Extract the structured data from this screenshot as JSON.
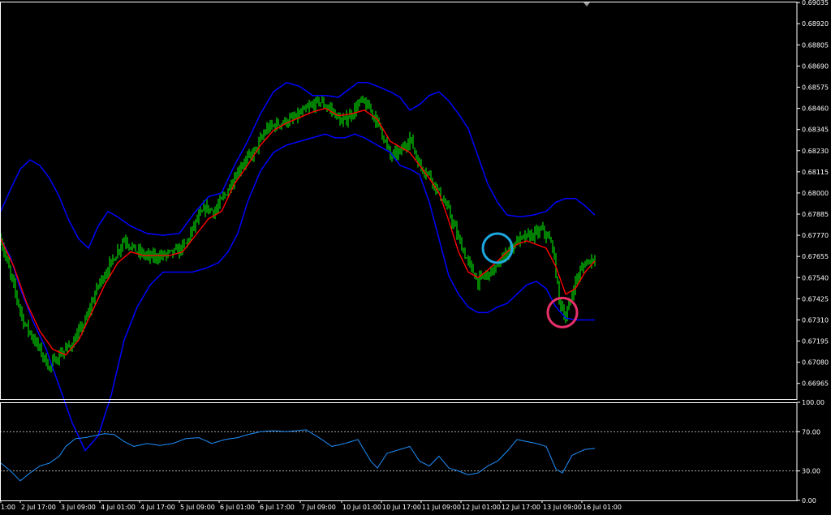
{
  "colors": {
    "background": "#000000",
    "frame": "#ffffff",
    "candle": "#00ff00",
    "moving_average": "#ff0000",
    "bollinger": "#0000ff",
    "rsi": "#1e90ff",
    "rsi_levels": "#c0c0c0",
    "annotation_blue": "#1ea8e0",
    "annotation_pink": "#e8306a"
  },
  "chart_data": [
    {
      "type": "candlestick",
      "panel": "price",
      "ylim": [
        0.6688,
        0.6904
      ],
      "y_ticks": [
        "0.69035",
        "0.68920",
        "0.68805",
        "0.68690",
        "0.68575",
        "0.68460",
        "0.68345",
        "0.68230",
        "0.68115",
        "0.68000",
        "0.67885",
        "0.67770",
        "0.67655",
        "0.67540",
        "0.67425",
        "0.67310",
        "0.67195",
        "0.67080",
        "0.66965"
      ],
      "x_ticks": [
        "1:00",
        "2 Jul 17:00",
        "3 Jul 09:00",
        "4 Jul 01:00",
        "4 Jul 17:00",
        "5 Jul 09:00",
        "6 Jul 01:00",
        "6 Jul 17:00",
        "7 Jul 09:00",
        "10 Jul 01:00",
        "10 Jul 17:00",
        "11 Jul 09:00",
        "12 Jul 01:00",
        "12 Jul 17:00",
        "13 Jul 09:00",
        "16 Jul 01:00"
      ],
      "close_anchors": [
        [
          0,
          0.6775
        ],
        [
          6,
          0.6755
        ],
        [
          14,
          0.673
        ],
        [
          22,
          0.6718
        ],
        [
          30,
          0.6705
        ],
        [
          36,
          0.6712
        ],
        [
          44,
          0.6718
        ],
        [
          52,
          0.673
        ],
        [
          60,
          0.675
        ],
        [
          68,
          0.6762
        ],
        [
          76,
          0.6775
        ],
        [
          84,
          0.6768
        ],
        [
          92,
          0.6765
        ],
        [
          100,
          0.6766
        ],
        [
          108,
          0.6768
        ],
        [
          114,
          0.6772
        ],
        [
          120,
          0.6784
        ],
        [
          126,
          0.6792
        ],
        [
          132,
          0.679
        ],
        [
          140,
          0.6802
        ],
        [
          148,
          0.6815
        ],
        [
          156,
          0.6822
        ],
        [
          164,
          0.6835
        ],
        [
          172,
          0.6838
        ],
        [
          180,
          0.684
        ],
        [
          188,
          0.6845
        ],
        [
          196,
          0.685
        ],
        [
          204,
          0.6845
        ],
        [
          210,
          0.6838
        ],
        [
          216,
          0.6843
        ],
        [
          222,
          0.685
        ],
        [
          228,
          0.6845
        ],
        [
          234,
          0.6835
        ],
        [
          240,
          0.682
        ],
        [
          246,
          0.6822
        ],
        [
          252,
          0.683
        ],
        [
          258,
          0.6815
        ],
        [
          264,
          0.681
        ],
        [
          270,
          0.68
        ],
        [
          276,
          0.679
        ],
        [
          282,
          0.6775
        ],
        [
          288,
          0.6762
        ],
        [
          294,
          0.6752
        ],
        [
          300,
          0.6756
        ],
        [
          306,
          0.676
        ],
        [
          312,
          0.6768
        ],
        [
          318,
          0.6774
        ],
        [
          324,
          0.6776
        ],
        [
          330,
          0.6778
        ],
        [
          334,
          0.678
        ],
        [
          340,
          0.6771
        ],
        [
          344,
          0.6742
        ],
        [
          348,
          0.6732
        ],
        [
          354,
          0.6752
        ],
        [
          360,
          0.6762
        ],
        [
          366,
          0.6765
        ]
      ],
      "ma_anchors": [
        [
          0,
          0.6775
        ],
        [
          8,
          0.676
        ],
        [
          16,
          0.674
        ],
        [
          24,
          0.6725
        ],
        [
          32,
          0.6715
        ],
        [
          40,
          0.6712
        ],
        [
          48,
          0.672
        ],
        [
          56,
          0.6735
        ],
        [
          64,
          0.675
        ],
        [
          72,
          0.6762
        ],
        [
          80,
          0.6768
        ],
        [
          88,
          0.6766
        ],
        [
          96,
          0.6766
        ],
        [
          104,
          0.6766
        ],
        [
          112,
          0.6768
        ],
        [
          120,
          0.6777
        ],
        [
          128,
          0.6786
        ],
        [
          136,
          0.679
        ],
        [
          144,
          0.6805
        ],
        [
          152,
          0.6815
        ],
        [
          160,
          0.6826
        ],
        [
          168,
          0.6834
        ],
        [
          176,
          0.6838
        ],
        [
          184,
          0.6841
        ],
        [
          192,
          0.6844
        ],
        [
          200,
          0.6846
        ],
        [
          208,
          0.6842
        ],
        [
          216,
          0.6843
        ],
        [
          224,
          0.6845
        ],
        [
          232,
          0.684
        ],
        [
          240,
          0.6828
        ],
        [
          246,
          0.6825
        ],
        [
          252,
          0.6822
        ],
        [
          258,
          0.6815
        ],
        [
          264,
          0.6808
        ],
        [
          270,
          0.68
        ],
        [
          276,
          0.6785
        ],
        [
          282,
          0.6768
        ],
        [
          288,
          0.6757
        ],
        [
          294,
          0.6754
        ],
        [
          300,
          0.6758
        ],
        [
          306,
          0.6763
        ],
        [
          312,
          0.6768
        ],
        [
          318,
          0.6772
        ],
        [
          324,
          0.6774
        ],
        [
          330,
          0.6772
        ],
        [
          336,
          0.677
        ],
        [
          342,
          0.676
        ],
        [
          348,
          0.6745
        ],
        [
          354,
          0.6748
        ],
        [
          360,
          0.6757
        ],
        [
          366,
          0.6763
        ]
      ],
      "bollinger_upper_anchors": [
        [
          0,
          0.679
        ],
        [
          6,
          0.6802
        ],
        [
          12,
          0.6813
        ],
        [
          18,
          0.6818
        ],
        [
          24,
          0.6815
        ],
        [
          30,
          0.6808
        ],
        [
          36,
          0.6798
        ],
        [
          42,
          0.6785
        ],
        [
          48,
          0.6775
        ],
        [
          54,
          0.677
        ],
        [
          60,
          0.6782
        ],
        [
          66,
          0.679
        ],
        [
          72,
          0.6787
        ],
        [
          80,
          0.6782
        ],
        [
          90,
          0.6778
        ],
        [
          100,
          0.6777
        ],
        [
          110,
          0.6778
        ],
        [
          120,
          0.679
        ],
        [
          128,
          0.6798
        ],
        [
          136,
          0.68
        ],
        [
          144,
          0.6815
        ],
        [
          152,
          0.6828
        ],
        [
          160,
          0.6843
        ],
        [
          168,
          0.6855
        ],
        [
          176,
          0.686
        ],
        [
          184,
          0.6858
        ],
        [
          192,
          0.6853
        ],
        [
          200,
          0.6853
        ],
        [
          208,
          0.6852
        ],
        [
          214,
          0.6856
        ],
        [
          220,
          0.686
        ],
        [
          226,
          0.686
        ],
        [
          232,
          0.6858
        ],
        [
          240,
          0.6855
        ],
        [
          246,
          0.6852
        ],
        [
          252,
          0.6845
        ],
        [
          258,
          0.6848
        ],
        [
          264,
          0.6853
        ],
        [
          270,
          0.6855
        ],
        [
          276,
          0.685
        ],
        [
          282,
          0.6843
        ],
        [
          288,
          0.6835
        ],
        [
          294,
          0.682
        ],
        [
          300,
          0.6805
        ],
        [
          306,
          0.6795
        ],
        [
          312,
          0.6788
        ],
        [
          320,
          0.6787
        ],
        [
          328,
          0.6788
        ],
        [
          336,
          0.679
        ],
        [
          342,
          0.6795
        ],
        [
          348,
          0.6797
        ],
        [
          354,
          0.6797
        ],
        [
          360,
          0.6793
        ],
        [
          366,
          0.6788
        ]
      ],
      "bollinger_lower_anchors": [
        [
          0,
          0.6775
        ],
        [
          6,
          0.6765
        ],
        [
          12,
          0.6748
        ],
        [
          20,
          0.673
        ],
        [
          28,
          0.6715
        ],
        [
          36,
          0.6695
        ],
        [
          44,
          0.6675
        ],
        [
          52,
          0.666
        ],
        [
          60,
          0.6668
        ],
        [
          68,
          0.669
        ],
        [
          76,
          0.672
        ],
        [
          84,
          0.6738
        ],
        [
          92,
          0.675
        ],
        [
          100,
          0.6757
        ],
        [
          110,
          0.6757
        ],
        [
          118,
          0.6757
        ],
        [
          126,
          0.6759
        ],
        [
          134,
          0.6762
        ],
        [
          140,
          0.6768
        ],
        [
          146,
          0.6778
        ],
        [
          152,
          0.6795
        ],
        [
          160,
          0.6812
        ],
        [
          168,
          0.6822
        ],
        [
          176,
          0.6826
        ],
        [
          184,
          0.6828
        ],
        [
          192,
          0.683
        ],
        [
          200,
          0.6832
        ],
        [
          206,
          0.683
        ],
        [
          212,
          0.683
        ],
        [
          218,
          0.6832
        ],
        [
          224,
          0.683
        ],
        [
          232,
          0.6826
        ],
        [
          240,
          0.6822
        ],
        [
          246,
          0.6815
        ],
        [
          252,
          0.6813
        ],
        [
          258,
          0.681
        ],
        [
          264,
          0.6795
        ],
        [
          270,
          0.6775
        ],
        [
          276,
          0.6755
        ],
        [
          282,
          0.6745
        ],
        [
          288,
          0.6738
        ],
        [
          294,
          0.6735
        ],
        [
          300,
          0.6735
        ],
        [
          306,
          0.6738
        ],
        [
          312,
          0.674
        ],
        [
          318,
          0.6745
        ],
        [
          324,
          0.675
        ],
        [
          330,
          0.6752
        ],
        [
          336,
          0.6748
        ],
        [
          342,
          0.6738
        ],
        [
          348,
          0.6732
        ],
        [
          354,
          0.6731
        ],
        [
          360,
          0.6731
        ],
        [
          366,
          0.6731
        ]
      ],
      "annotations": [
        {
          "shape": "circle",
          "color": "annotation_blue",
          "bar": 306,
          "price": 0.677
        },
        {
          "shape": "circle",
          "color": "annotation_pink",
          "bar": 346,
          "price": 0.6735
        }
      ]
    },
    {
      "type": "line",
      "panel": "rsi",
      "ylim": [
        0,
        100
      ],
      "y_ticks": [
        "100.00",
        "70.00",
        "30.00",
        "0.00"
      ],
      "levels": [
        70,
        30
      ],
      "anchors": [
        [
          0,
          38
        ],
        [
          6,
          30
        ],
        [
          12,
          20
        ],
        [
          18,
          28
        ],
        [
          24,
          35
        ],
        [
          30,
          38
        ],
        [
          36,
          45
        ],
        [
          40,
          55
        ],
        [
          46,
          63
        ],
        [
          52,
          64
        ],
        [
          58,
          66
        ],
        [
          64,
          68
        ],
        [
          70,
          67
        ],
        [
          76,
          60
        ],
        [
          82,
          55
        ],
        [
          90,
          58
        ],
        [
          98,
          56
        ],
        [
          106,
          58
        ],
        [
          114,
          63
        ],
        [
          122,
          64
        ],
        [
          130,
          58
        ],
        [
          138,
          62
        ],
        [
          146,
          64
        ],
        [
          152,
          67
        ],
        [
          160,
          70
        ],
        [
          168,
          71
        ],
        [
          176,
          70
        ],
        [
          182,
          71
        ],
        [
          188,
          72
        ],
        [
          196,
          64
        ],
        [
          204,
          55
        ],
        [
          212,
          58
        ],
        [
          220,
          62
        ],
        [
          228,
          40
        ],
        [
          232,
          33
        ],
        [
          238,
          48
        ],
        [
          246,
          52
        ],
        [
          252,
          55
        ],
        [
          258,
          40
        ],
        [
          264,
          35
        ],
        [
          270,
          45
        ],
        [
          276,
          33
        ],
        [
          282,
          30
        ],
        [
          288,
          26
        ],
        [
          294,
          28
        ],
        [
          300,
          35
        ],
        [
          306,
          40
        ],
        [
          312,
          50
        ],
        [
          318,
          62
        ],
        [
          324,
          60
        ],
        [
          330,
          58
        ],
        [
          336,
          55
        ],
        [
          342,
          32
        ],
        [
          346,
          28
        ],
        [
          352,
          46
        ],
        [
          360,
          52
        ],
        [
          366,
          53
        ]
      ]
    }
  ]
}
